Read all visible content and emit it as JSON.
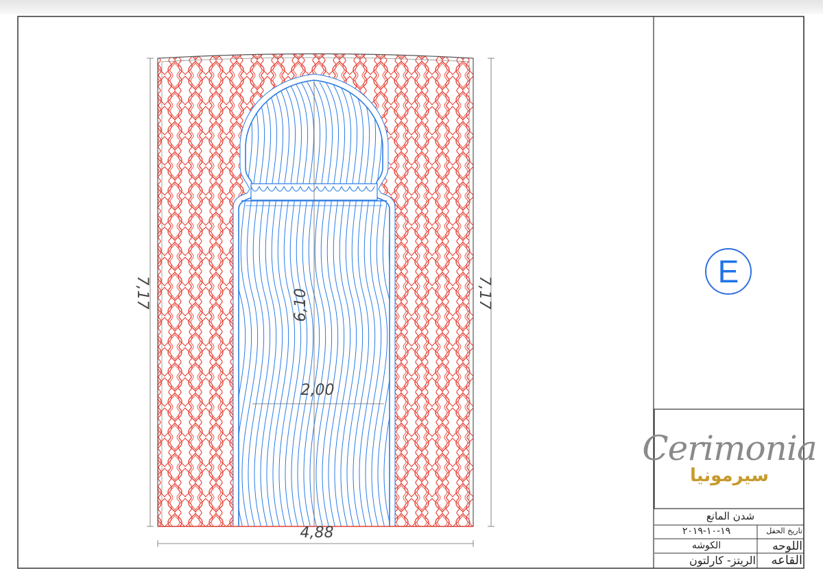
{
  "drawing": {
    "dimensions": {
      "height_left": "7,17",
      "height_right": "7,17",
      "inner_height": "6,10",
      "inner_width": "2,00",
      "total_width": "4,88"
    },
    "colors": {
      "lattice": "#e8473c",
      "arch": "#2a7be4",
      "frame": "#555555"
    }
  },
  "sheet_badge": "E",
  "logo": {
    "latin": "Cerimonia",
    "arabic": "سيرمونيا"
  },
  "title_block": {
    "project": "شدن المانع",
    "date_label": "تاريخ الحفل",
    "date_value": "١٩-١٠-٢٠١٩",
    "board_label": "اللوحه",
    "board_value": "الكوشه",
    "hall_label": "القاعه",
    "hall_value": "الريتز- كارلتون"
  }
}
